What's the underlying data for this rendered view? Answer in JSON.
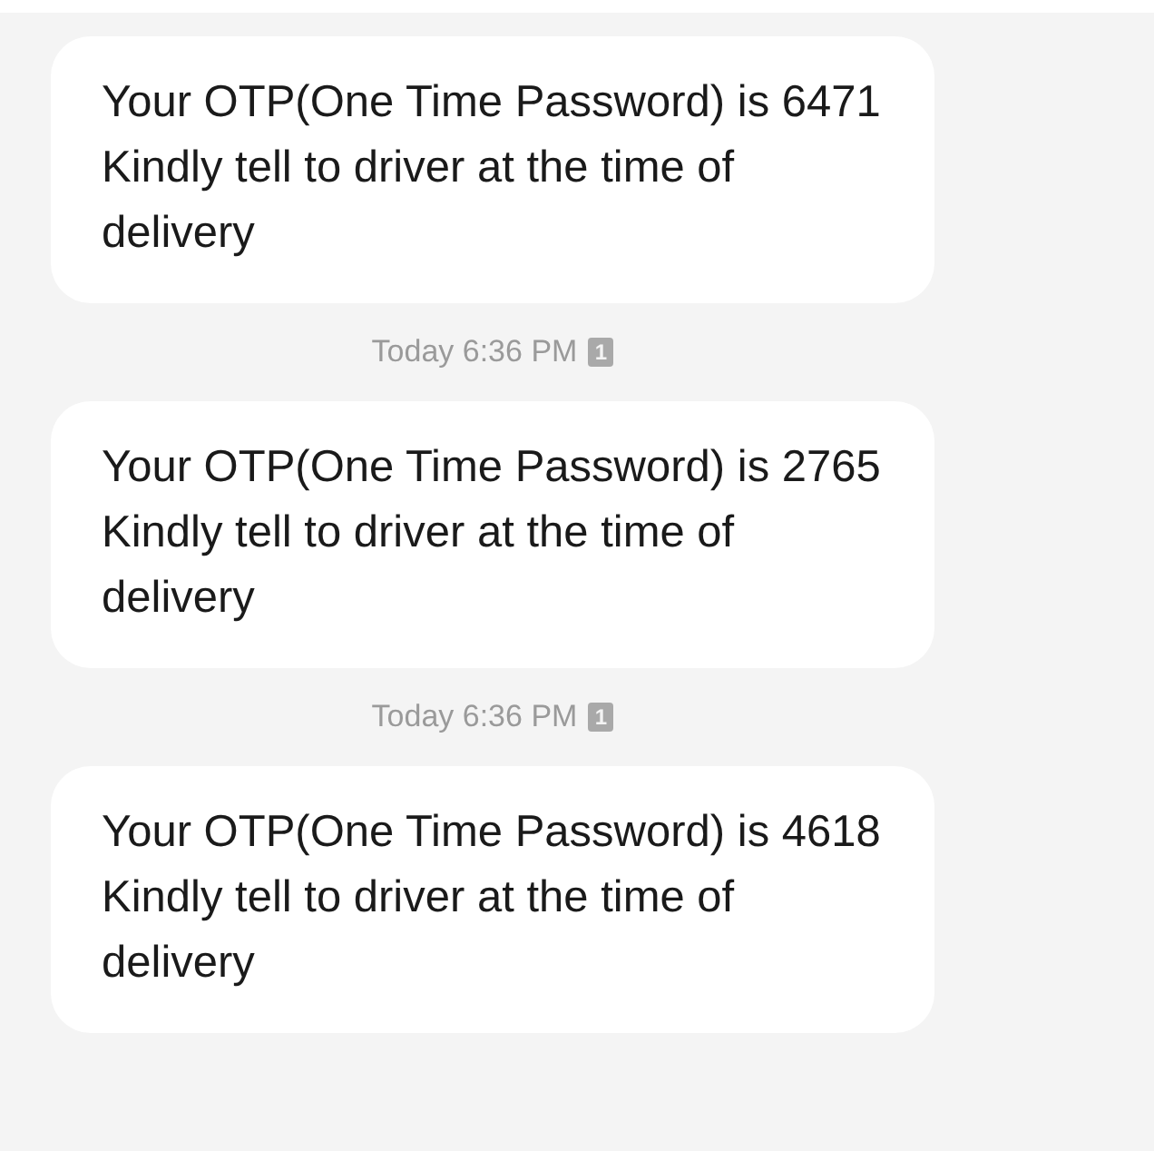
{
  "messages": [
    {
      "text": "Your OTP(One Time Password) is 6471 Kindly tell to driver at the time of delivery",
      "time": "Today 6:36 PM",
      "sim": "1"
    },
    {
      "text": "Your OTP(One Time Password) is 2765 Kindly tell to driver at the time of delivery",
      "time": "Today 6:36 PM",
      "sim": "1"
    },
    {
      "text": "Your OTP(One Time Password) is 4618 Kindly tell to driver at the time of delivery"
    }
  ]
}
